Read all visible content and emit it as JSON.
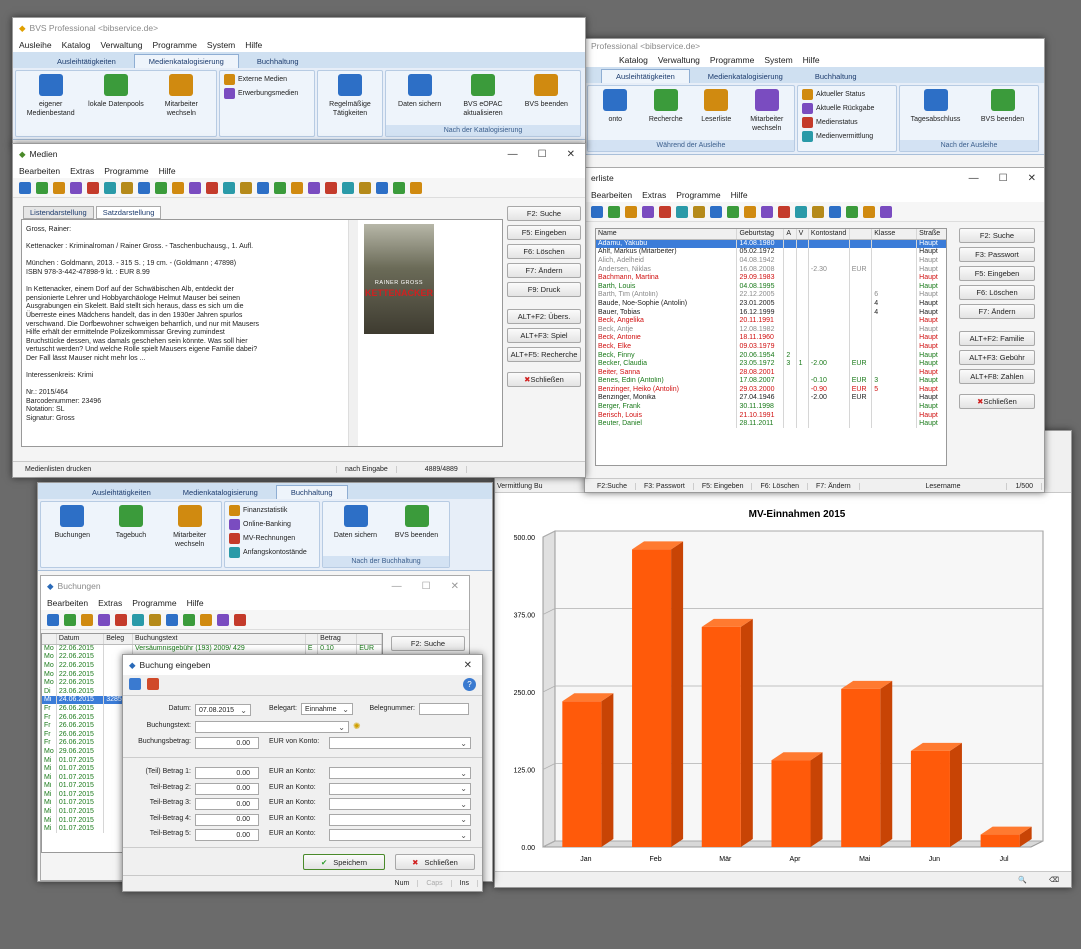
{
  "bg_window": {
    "title": "BVS Professional <bibservice.de>",
    "menu": [
      "Ausleihe",
      "Katalog",
      "Verwaltung",
      "Programme",
      "System",
      "Hilfe"
    ],
    "tabs": [
      "Ausleihtätigkeiten",
      "Medienkatalogisierung",
      "Buchhaltung"
    ],
    "g1": [
      {
        "label": "eigener Medienbestand"
      },
      {
        "label": "lokale Datenpools"
      },
      {
        "label": "Mitarbeiter wechseln"
      }
    ],
    "g2": [
      "Externe Medien",
      "Erwerbungsmedien"
    ],
    "g3": [
      {
        "label": "Regelmäßige Tätigkeiten"
      }
    ],
    "g4": [
      {
        "label": "Daten sichern"
      },
      {
        "label": "BVS eOPAC aktualisieren"
      },
      {
        "label": "BVS beenden"
      }
    ],
    "g4_label": "Nach der Katalogisierung"
  },
  "ausleihe_window": {
    "title": "Professional <bibservice.de>",
    "menu": [
      "Katalog",
      "Verwaltung",
      "Programme",
      "System",
      "Hilfe"
    ],
    "tabs": [
      "Ausleihtätigkeiten",
      "Medienkatalogisierung",
      "Buchhaltung"
    ],
    "g1": [
      {
        "label": "onto"
      },
      {
        "label": "Recherche"
      },
      {
        "label": "Leserliste"
      },
      {
        "label": "Mitarbeiter wechseln"
      }
    ],
    "g1_label": "Während der Ausleihe",
    "g2": [
      "Aktueller Status",
      "Aktuelle Rückgabe",
      "Medienstatus",
      "Medienvermittlung"
    ],
    "g3": [
      {
        "label": "Tagesabschluss"
      },
      {
        "label": "BVS beenden"
      }
    ],
    "g3_label": "Nach der Ausleihe"
  },
  "leserliste": {
    "title": "erliste",
    "menu": [
      "Bearbeiten",
      "Extras",
      "Programme",
      "Hilfe"
    ],
    "headers": [
      "Name",
      "Geburtstag",
      "A",
      "V",
      "Kontostand",
      "",
      "Klasse",
      "Straße"
    ],
    "rows": [
      {
        "c": "sel",
        "v": [
          "Adamu, Yakubu",
          "14.08.1980",
          "",
          "",
          "",
          "",
          "",
          "Haupt"
        ]
      },
      {
        "c": "",
        "v": [
          "Ahlf, Markus (Mitarbeiter)",
          "05.02.1972",
          "",
          "",
          "",
          "",
          "",
          "Haupt"
        ]
      },
      {
        "c": "gr",
        "v": [
          "Alich, Adelheid",
          "04.08.1942",
          "",
          "",
          "",
          "",
          "",
          "Haupt"
        ]
      },
      {
        "c": "gr",
        "v": [
          "Andersen, Niklas",
          "16.08.2008",
          "",
          "",
          "-2.30",
          "EUR",
          "",
          "Haupt"
        ]
      },
      {
        "c": "r",
        "v": [
          "Bachmann, Martina",
          "29.09.1983",
          "",
          "",
          "",
          "",
          "",
          "Haupt"
        ]
      },
      {
        "c": "g",
        "v": [
          "Barth, Louis",
          "04.08.1995",
          "",
          "",
          "",
          "",
          "",
          "Haupt"
        ]
      },
      {
        "c": "gr",
        "v": [
          "Barth, Tim (Antolin)",
          "22.12.2005",
          "",
          "",
          "",
          "",
          "6",
          "Haupt"
        ]
      },
      {
        "c": "",
        "v": [
          "Baude, Noe-Sophie (Antolin)",
          "23.01.2005",
          "",
          "",
          "",
          "",
          "4",
          "Haupt"
        ]
      },
      {
        "c": "",
        "v": [
          "Bauer, Tobias",
          "16.12.1999",
          "",
          "",
          "",
          "",
          "4",
          "Haupt"
        ]
      },
      {
        "c": "r",
        "v": [
          "Beck, Angelika",
          "20.11.1991",
          "",
          "",
          "",
          "",
          "",
          "Haupt"
        ]
      },
      {
        "c": "gr",
        "v": [
          "Beck, Antje",
          "12.08.1982",
          "",
          "",
          "",
          "",
          "",
          "Haupt"
        ]
      },
      {
        "c": "r",
        "v": [
          "Beck, Antonie",
          "18.11.1960",
          "",
          "",
          "",
          "",
          "",
          "Haupt"
        ]
      },
      {
        "c": "r",
        "v": [
          "Beck, Elke",
          "09.03.1979",
          "",
          "",
          "",
          "",
          "",
          "Haupt"
        ]
      },
      {
        "c": "g",
        "v": [
          "Beck, Finny",
          "20.06.1954",
          "2",
          "",
          "",
          "",
          "",
          "Haupt"
        ]
      },
      {
        "c": "g",
        "v": [
          "Becker, Claudia",
          "23.05.1972",
          "3",
          "1",
          "-2.00",
          "EUR",
          "",
          "Haupt"
        ]
      },
      {
        "c": "r",
        "v": [
          "Beiter, Sanna",
          "28.08.2001",
          "",
          "",
          "",
          "",
          "",
          "Haupt"
        ]
      },
      {
        "c": "g",
        "v": [
          "Benes, Edin (Antolin)",
          "17.08.2007",
          "",
          "",
          "-0.10",
          "EUR",
          "3",
          "Haupt"
        ]
      },
      {
        "c": "r",
        "v": [
          "Benzinger, Heiko (Antolin)",
          "29.03.2000",
          "",
          "",
          "-0.90",
          "EUR",
          "5",
          "Haupt"
        ]
      },
      {
        "c": "",
        "v": [
          "Benzinger, Monika",
          "27.04.1946",
          "",
          "",
          "-2.00",
          "EUR",
          "",
          "Haupt"
        ]
      },
      {
        "c": "g",
        "v": [
          "Berger, Frank",
          "30.11.1998",
          "",
          "",
          "",
          "",
          "",
          "Haupt"
        ]
      },
      {
        "c": "r",
        "v": [
          "Berisch, Louis",
          "21.10.1991",
          "",
          "",
          "",
          "",
          "",
          "Haupt"
        ]
      },
      {
        "c": "g",
        "v": [
          "Beuter, Daniel",
          "28.11.2011",
          "",
          "",
          "",
          "",
          "",
          "Haupt"
        ]
      }
    ],
    "side_buttons": [
      "F2: Suche",
      "F3: Passwort",
      "F5: Eingeben",
      "F6: Löschen",
      "F7: Ändern",
      "ALT+F2: Familie",
      "ALT+F3: Gebühr",
      "ALT+F8: Zahlen",
      "Schließen"
    ],
    "status": [
      "F2:Suche",
      "F3: Passwort",
      "F5: Eingeben",
      "F6: Löschen",
      "F7: Ändern",
      "Lesername",
      "1/500"
    ]
  },
  "medien": {
    "title": "Medien",
    "menu": [
      "Bearbeiten",
      "Extras",
      "Programme",
      "Hilfe"
    ],
    "tabs": [
      "Listendarstellung",
      "Satzdarstellung"
    ],
    "text": [
      "Gross, Rainer:",
      "",
      "Kettenacker : Kriminalroman / Rainer Gross. - Taschenbuchausg., 1. Aufl.",
      "",
      "München : Goldmann, 2013. - 315 S. ; 19 cm. - (Goldmann ; 47898)",
      "ISBN 978-3-442-47898-9 kt. : EUR 8.99",
      "",
      "In Kettenacker, einem Dorf auf der Schwäbischen Alb, entdeckt der",
      "pensionierte Lehrer und Hobbyarchäologe Helmut Mauser bei seinen",
      "Ausgrabungen ein Skelett. Bald stellt sich heraus, dass es sich um die",
      "Überreste eines Mädchens handelt, das in den 1930er Jahren spurlos",
      "verschwand. Die Dorfbewohner schweigen beharrlich, und nur mit Mausers",
      "Hilfe erhält der ermittelnde Polizeikommissar Greving zumindest",
      "Bruchstücke dessen, was damals geschehen sein könnte. Was soll hier",
      "vertuscht werden? Und welche Rolle spielt Mausers eigene Familie dabei?",
      "Der Fall lässt Mauser nicht mehr los ...",
      "",
      "Interessenkreis: Krimi",
      "",
      "Nr.: 2015/464",
      "Barcodenummer: 23496",
      "Notation: SL",
      "Signatur: Gross"
    ],
    "cover_author": "RAINER GROSS",
    "cover_title": "KETTENACKER",
    "side_buttons": [
      "F2: Suche",
      "F5: Eingeben",
      "F6: Löschen",
      "F7: Ändern",
      "F9: Druck",
      "ALT+F2: Übers.",
      "ALT+F3: Spiel",
      "ALT+F5: Recherche",
      "Schließen"
    ],
    "status": [
      "Medienlisten drucken",
      "nach Eingabe",
      "4889/4889"
    ]
  },
  "chart_window": {
    "status_left": "Vermittlung Bu"
  },
  "chart_data": {
    "type": "bar",
    "title": "MV-Einnahmen 2015",
    "categories": [
      "Jan",
      "Feb",
      "Mär",
      "Apr",
      "Mai",
      "Jun",
      "Jul"
    ],
    "values": [
      235,
      480,
      355,
      140,
      255,
      155,
      20
    ],
    "ylim": [
      0,
      500
    ],
    "yticks": [
      "0.00",
      "125.00",
      "250.00",
      "375.00",
      "500.00"
    ],
    "color": "#ff5a0a"
  },
  "buch_window": {
    "tabs": [
      "Ausleihtätigkeiten",
      "Medienkatalogisierung",
      "Buchhaltung"
    ],
    "g1": [
      {
        "label": "Buchungen"
      },
      {
        "label": "Tagebuch"
      },
      {
        "label": "Mitarbeiter wechseln"
      }
    ],
    "g2": [
      "Finanzstatistik",
      "Online-Banking",
      "MV-Rechnungen",
      "Anfangskontostände"
    ],
    "g3": [
      {
        "label": "Daten sichern"
      },
      {
        "label": "BVS beenden"
      }
    ],
    "g3_label": "Nach der Buchhaltung"
  },
  "buchungen": {
    "title": "Buchungen",
    "menu": [
      "Bearbeiten",
      "Extras",
      "Programme",
      "Hilfe"
    ],
    "headers": [
      "",
      "Datum",
      "Beleg",
      "Buchungstext",
      "",
      "Betrag",
      ""
    ],
    "rows": [
      {
        "c": "g",
        "v": [
          "Mo",
          "22.06.2015",
          "",
          "Versäumnisgebühr (193) 2009/ 429",
          "E",
          "0.10",
          "EUR"
        ]
      },
      {
        "c": "g",
        "v": [
          "Mo",
          "22.06.2015",
          "",
          "",
          "",
          "",
          ""
        ]
      },
      {
        "c": "g",
        "v": [
          "Mo",
          "22.06.2015",
          "",
          "",
          "",
          "",
          ""
        ]
      },
      {
        "c": "g",
        "v": [
          "Mo",
          "22.06.2015",
          "",
          "",
          "",
          "",
          ""
        ]
      },
      {
        "c": "g",
        "v": [
          "Mo",
          "22.06.2015",
          "",
          "",
          "",
          "",
          ""
        ]
      },
      {
        "c": "g",
        "v": [
          "Di",
          "23.06.2015",
          "",
          "",
          "",
          "",
          ""
        ]
      },
      {
        "c": "sel",
        "v": [
          "Mi",
          "24.06.2015",
          "3285",
          "",
          "",
          "",
          ""
        ]
      },
      {
        "c": "g",
        "v": [
          "Fr",
          "26.06.2015",
          "",
          "",
          "",
          "",
          ""
        ]
      },
      {
        "c": "g",
        "v": [
          "Fr",
          "26.06.2015",
          "",
          "",
          "",
          "",
          ""
        ]
      },
      {
        "c": "g",
        "v": [
          "Fr",
          "26.06.2015",
          "",
          "",
          "",
          "",
          ""
        ]
      },
      {
        "c": "g",
        "v": [
          "Fr",
          "26.06.2015",
          "",
          "",
          "",
          "",
          ""
        ]
      },
      {
        "c": "g",
        "v": [
          "Fr",
          "26.06.2015",
          "",
          "",
          "",
          "",
          ""
        ]
      },
      {
        "c": "g",
        "v": [
          "Mo",
          "29.06.2015",
          "",
          "",
          "",
          "",
          ""
        ]
      },
      {
        "c": "g",
        "v": [
          "Mi",
          "01.07.2015",
          "",
          "",
          "",
          "",
          ""
        ]
      },
      {
        "c": "g",
        "v": [
          "Mi",
          "01.07.2015",
          "",
          "",
          "",
          "",
          ""
        ]
      },
      {
        "c": "g",
        "v": [
          "Mi",
          "01.07.2015",
          "",
          "",
          "",
          "",
          ""
        ]
      },
      {
        "c": "g",
        "v": [
          "Mi",
          "01.07.2015",
          "",
          "",
          "",
          "",
          ""
        ]
      },
      {
        "c": "g",
        "v": [
          "Mi",
          "01.07.2015",
          "",
          "",
          "",
          "",
          ""
        ]
      },
      {
        "c": "g",
        "v": [
          "Mi",
          "01.07.2015",
          "",
          "",
          "",
          "",
          ""
        ]
      },
      {
        "c": "g",
        "v": [
          "Mi",
          "01.07.2015",
          "",
          "",
          "",
          "",
          ""
        ]
      },
      {
        "c": "g",
        "v": [
          "Mi",
          "01.07.2015",
          "",
          "",
          "",
          "",
          ""
        ]
      },
      {
        "c": "g",
        "v": [
          "Mi",
          "01.07.2015",
          "",
          "",
          "",
          "",
          ""
        ]
      }
    ],
    "side_button": "F2: Suche"
  },
  "dialog": {
    "title": "Buchung eingeben",
    "datum_label": "Datum:",
    "datum_value": "07.08.2015",
    "belegart_label": "Belegart:",
    "belegart_value": "Einnahme",
    "belegnummer_label": "Belegnummer:",
    "buchungstext_label": "Buchungstext:",
    "betrag_label": "Buchungsbetrag:",
    "betrag_value": "0.00",
    "von_konto_label": "EUR von Konto:",
    "teil": [
      {
        "label": "(Teil) Betrag 1:",
        "value": "0.00"
      },
      {
        "label": "Teil-Betrag 2:",
        "value": "0.00"
      },
      {
        "label": "Teil-Betrag 3:",
        "value": "0.00"
      },
      {
        "label": "Teil-Betrag 4:",
        "value": "0.00"
      },
      {
        "label": "Teil-Betrag 5:",
        "value": "0.00"
      }
    ],
    "an_konto_label": "EUR an Konto:",
    "save": "Speichern",
    "close": "Schließen",
    "status": [
      "Num",
      "Caps",
      "Ins"
    ]
  }
}
